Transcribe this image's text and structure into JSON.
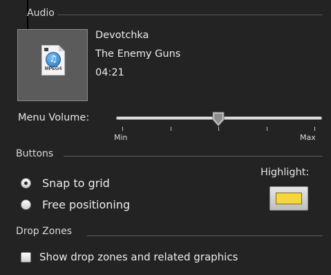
{
  "audio": {
    "section_title": "Audio",
    "thumbnail": {
      "icon": "mpeg4-audio-file-icon",
      "badge_text": "MPEG4"
    },
    "artist": "Devotchka",
    "track_title": "The Enemy Guns",
    "duration": "04:21"
  },
  "menu_volume": {
    "label": "Menu Volume:",
    "min_label": "Min",
    "max_label": "Max",
    "level": 0.5
  },
  "buttons": {
    "section_title": "Buttons",
    "positioning_options": [
      {
        "label": "Snap to grid",
        "selected": true
      },
      {
        "label": "Free positioning",
        "selected": false
      }
    ],
    "highlight_label": "Highlight:",
    "highlight_color": "#f6d63e"
  },
  "drop_zones": {
    "section_title": "Drop Zones",
    "show_checkbox_label": "Show drop zones and related graphics",
    "show_checked": false
  },
  "colors": {
    "panel_bg": "#232323",
    "text": "#e6e6e6",
    "separator": "#5a5a5a"
  }
}
